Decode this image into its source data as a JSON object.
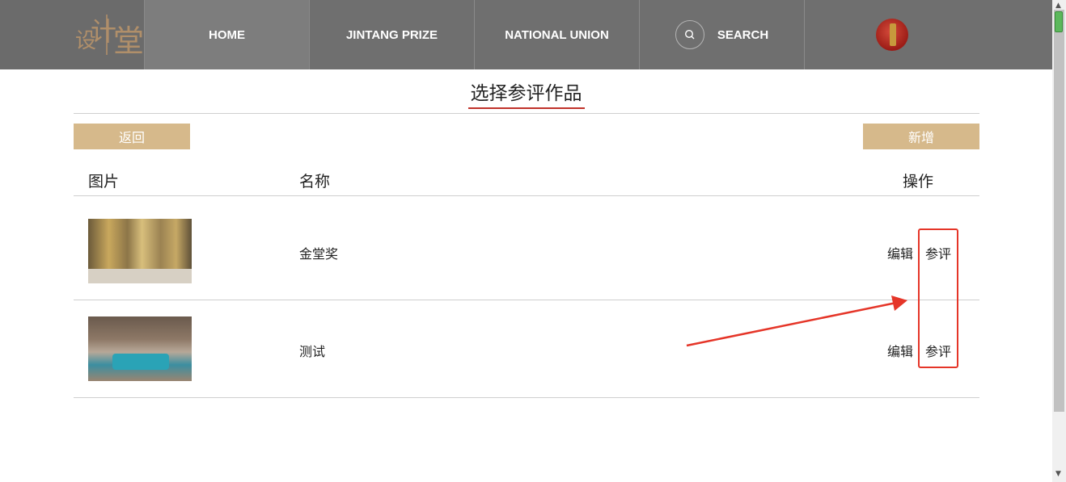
{
  "header": {
    "logo_chars": [
      "设",
      "计",
      "堂"
    ],
    "nav": [
      "HOME",
      "JINTANG PRIZE",
      "NATIONAL UNION"
    ],
    "search_label": "SEARCH"
  },
  "page": {
    "title": "选择参评作品",
    "back_button": "返回",
    "add_button": "新增"
  },
  "table": {
    "headers": {
      "image": "图片",
      "name": "名称",
      "action": "操作"
    },
    "rows": [
      {
        "name": "金堂奖",
        "edit": "编辑",
        "submit": "参评",
        "thumb": "trophy-photo"
      },
      {
        "name": "测试",
        "edit": "编辑",
        "submit": "参评",
        "thumb": "living-room-photo"
      }
    ]
  },
  "colors": {
    "nav_bg": "#6f6f6f",
    "button_bg": "#d6b98b",
    "accent_red": "#c0322a",
    "annotation_red": "#e53528"
  },
  "icons": [
    "search-icon",
    "user-avatar-icon",
    "arrow-annotation"
  ]
}
